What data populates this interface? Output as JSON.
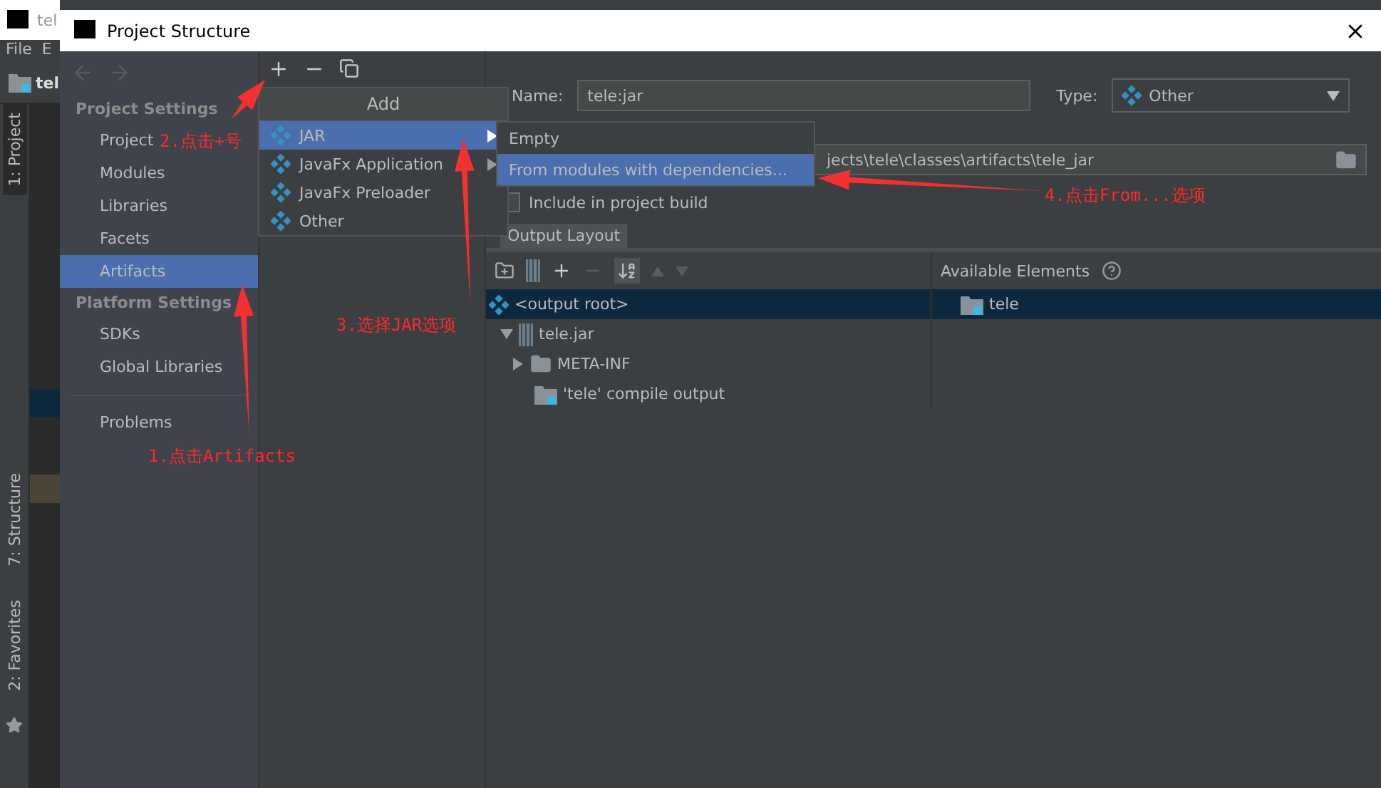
{
  "ide": {
    "title": "tel",
    "menu": [
      "File",
      "E"
    ],
    "project": "tel",
    "tool_windows": [
      {
        "label": "1: Project",
        "selected": true
      },
      {
        "label": "7: Structure",
        "selected": false
      },
      {
        "label": "2: Favorites",
        "selected": false
      }
    ]
  },
  "dialog": {
    "title": "Project Structure"
  },
  "nav": {
    "sections": [
      {
        "heading": "Project Settings",
        "items": [
          {
            "label": "Project",
            "selected": false
          },
          {
            "label": "Modules",
            "selected": false
          },
          {
            "label": "Libraries",
            "selected": false
          },
          {
            "label": "Facets",
            "selected": false
          },
          {
            "label": "Artifacts",
            "selected": true
          }
        ]
      },
      {
        "heading": "Platform Settings",
        "items": [
          {
            "label": "SDKs",
            "selected": false
          },
          {
            "label": "Global Libraries",
            "selected": false
          }
        ]
      }
    ],
    "extra_items": [
      {
        "label": "Problems",
        "selected": false
      }
    ]
  },
  "add_menu": {
    "title": "Add",
    "items": [
      {
        "label": "JAR",
        "selected": true,
        "submenu": true
      },
      {
        "label": "JavaFx Application",
        "selected": false,
        "submenu": true
      },
      {
        "label": "JavaFx Preloader",
        "selected": false,
        "submenu": false
      },
      {
        "label": "Other",
        "selected": false,
        "submenu": false
      }
    ]
  },
  "jar_submenu": {
    "items": [
      {
        "label": "Empty",
        "selected": false
      },
      {
        "label": "From modules with dependencies...",
        "selected": true
      }
    ]
  },
  "artifact": {
    "name_label": "Name:",
    "name": "tele:jar",
    "type_label": "Type:",
    "type": "Other",
    "output_path": "jects\\tele\\classes\\artifacts\\tele_jar",
    "include_in_build": {
      "label": "Include in project build",
      "checked": false
    }
  },
  "tabs": [
    {
      "label": "Output Layout",
      "selected": true
    }
  ],
  "layout_tree": [
    {
      "label": "<output root>",
      "kind": "root",
      "selected": true,
      "children": [
        {
          "label": "tele.jar",
          "kind": "jar",
          "selected": false,
          "expanded": true,
          "children": [
            {
              "label": "META-INF",
              "kind": "folder",
              "selected": false,
              "expanded": false
            },
            {
              "label": "'tele' compile output",
              "kind": "module",
              "selected": false
            }
          ]
        }
      ]
    }
  ],
  "available": {
    "title": "Available Elements",
    "items": [
      {
        "label": "tele",
        "kind": "module",
        "selected": true
      }
    ]
  },
  "annotations": [
    {
      "text": "2.点击+号"
    },
    {
      "text": "4.点击From...选项"
    },
    {
      "text": "3.选择JAR选项"
    },
    {
      "text": "1.点击Artifacts"
    }
  ]
}
